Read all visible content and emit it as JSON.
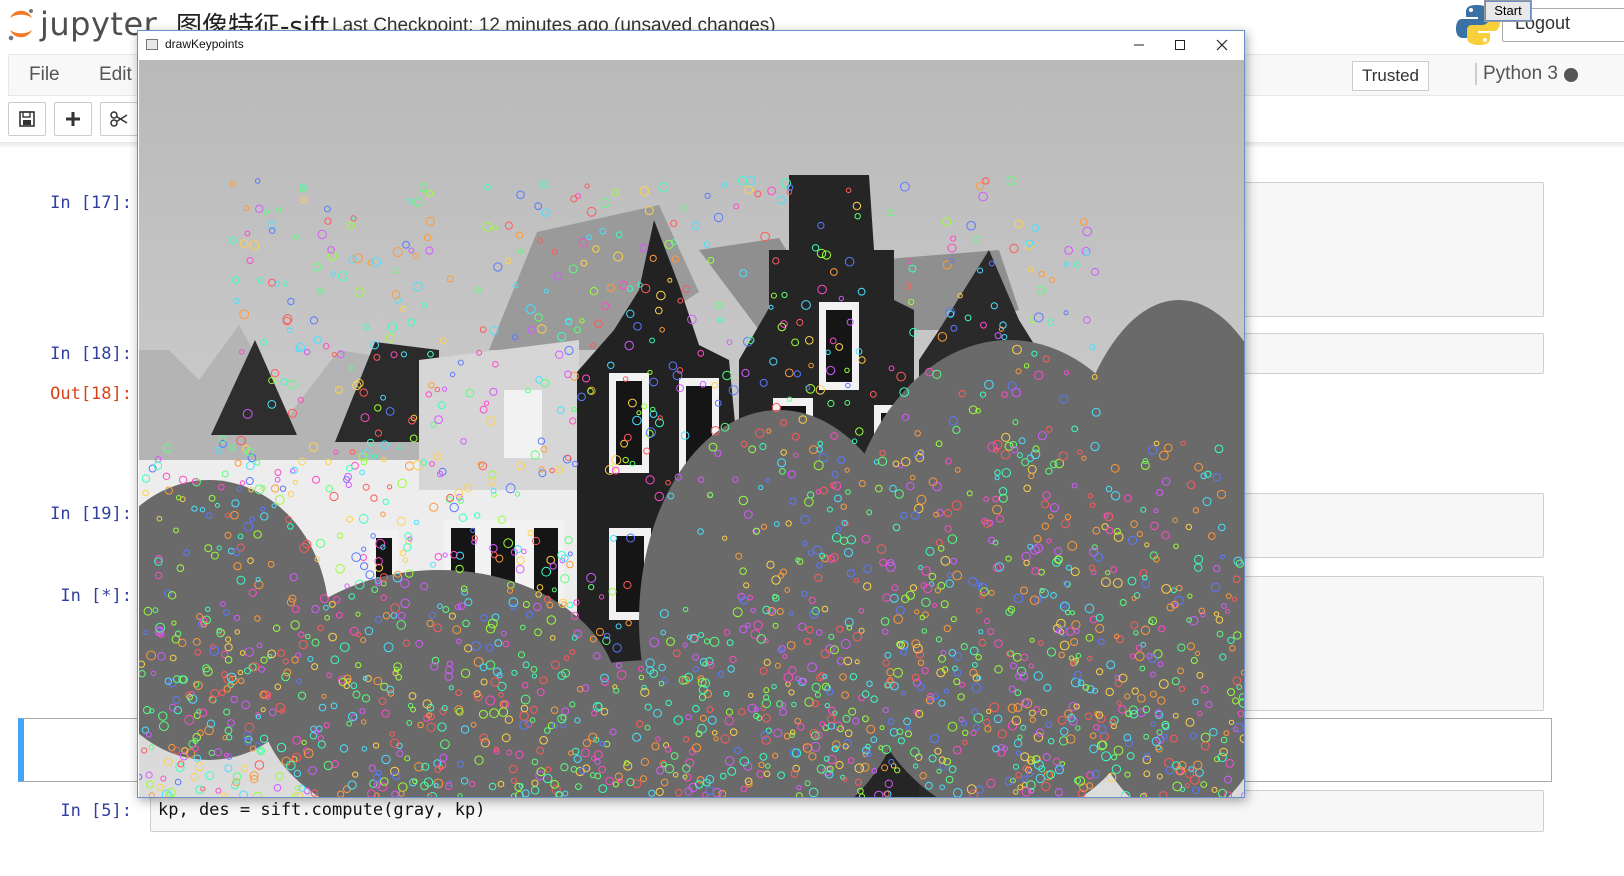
{
  "header": {
    "logo_text": "jupyter",
    "notebook_title": "图像特征-sift",
    "checkpoint_text": "Last Checkpoint: 12 minutes ago (unsaved changes)",
    "logout_label": "Logout",
    "start_label": "Start"
  },
  "menubar": {
    "items": [
      "File",
      "Edit"
    ],
    "trusted_label": "Trusted",
    "kernel_name": "Python 3"
  },
  "toolbar": {
    "buttons": [
      "save-icon",
      "plus-icon",
      "scissors-icon"
    ]
  },
  "cells": [
    {
      "prompt": "In [17]:"
    },
    {
      "prompt": "In [18]:"
    },
    {
      "out_prompt": "Out[18]:"
    },
    {
      "prompt": "In [19]:"
    },
    {
      "prompt": "In [*]:"
    },
    {
      "prompt": "In [5]:",
      "code": "kp, des = sift.compute(gray, kp)"
    }
  ],
  "cv_window": {
    "title": "drawKeypoints",
    "image_description_icon": "image-icon"
  },
  "colors": {
    "prompt_in": "#303f9f",
    "prompt_out": "#d84315",
    "selected_border": "#42a5f5",
    "window_border": "#6b8fc7"
  }
}
